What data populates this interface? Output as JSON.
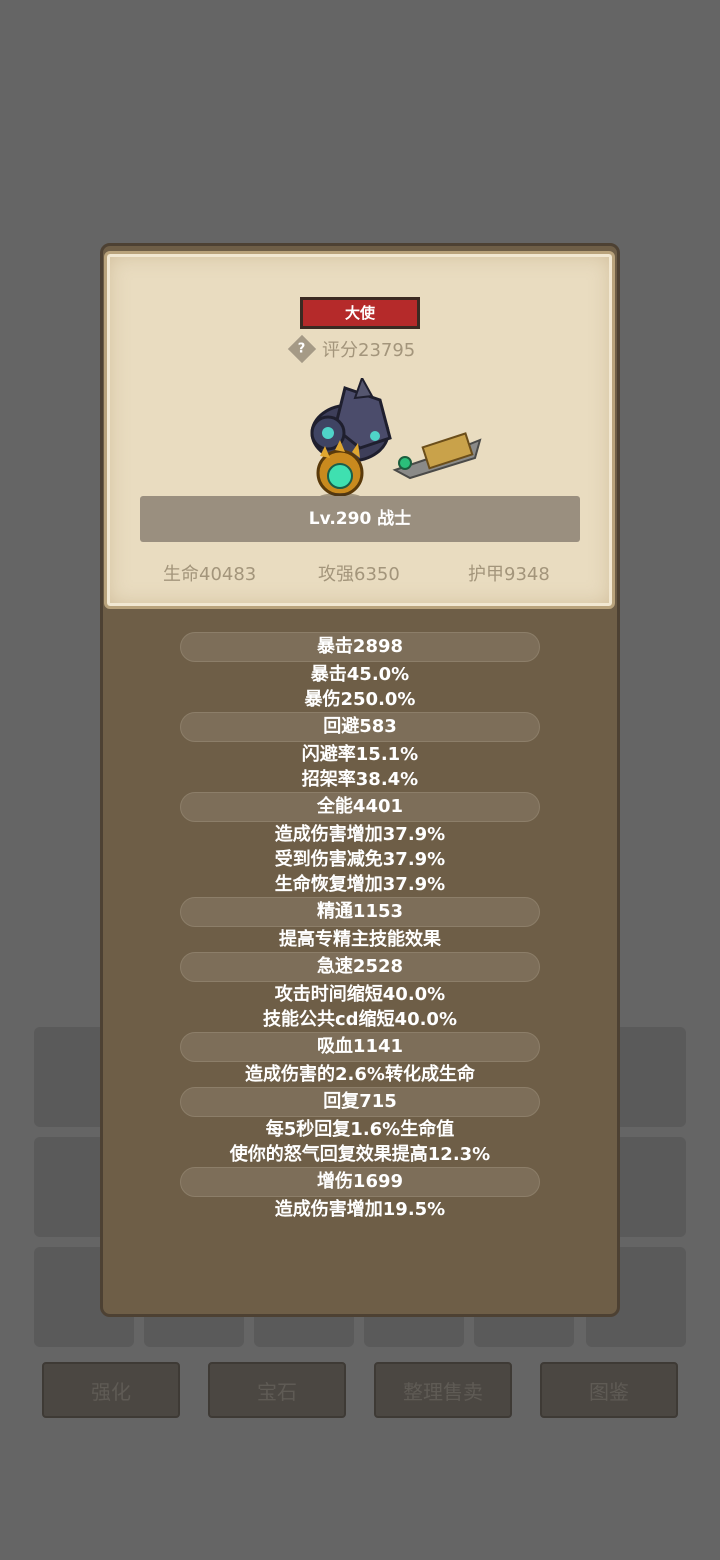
{
  "rank_badge": "大使",
  "score": "评分23795",
  "hero_name": "Lv.290 战士",
  "base_stats": {
    "hp": "生命40483",
    "attack": "攻强6350",
    "armor": "护甲9348"
  },
  "stats": [
    {
      "header": "暴击2898",
      "lines": [
        "暴击45.0%",
        "暴伤250.0%"
      ]
    },
    {
      "header": "回避583",
      "lines": [
        "闪避率15.1%",
        "招架率38.4%"
      ]
    },
    {
      "header": "全能4401",
      "lines": [
        "造成伤害增加37.9%",
        "受到伤害减免37.9%",
        "生命恢复增加37.9%"
      ]
    },
    {
      "header": "精通1153",
      "lines": [
        "提高专精主技能效果"
      ]
    },
    {
      "header": "急速2528",
      "lines": [
        "攻击时间缩短40.0%",
        "技能公共cd缩短40.0%"
      ]
    },
    {
      "header": "吸血1141",
      "lines": [
        "造成伤害的2.6%转化成生命"
      ]
    },
    {
      "header": "回复715",
      "lines": [
        "每5秒回复1.6%生命值",
        "使你的怒气回复效果提高12.3%"
      ]
    },
    {
      "header": "增伤1699",
      "lines": [
        "造成伤害增加19.5%"
      ]
    }
  ],
  "bottom_buttons": [
    "强化",
    "宝石",
    "整理售卖",
    "图鉴"
  ],
  "colors": {
    "rank_red": "#b52a2a",
    "panel_brown": "#6e5e47",
    "card_parchment": "#e9dcc0"
  },
  "icons": [
    "help-icon",
    "hero-warrior-sprite"
  ]
}
